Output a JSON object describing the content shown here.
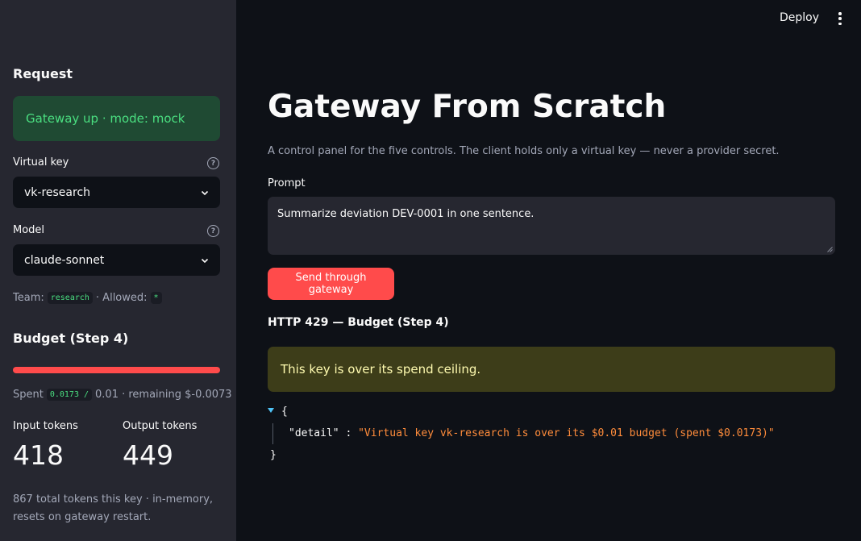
{
  "header": {
    "deploy_label": "Deploy"
  },
  "sidebar": {
    "request_heading": "Request",
    "status_text": "Gateway up · mode: mock",
    "virtual_key": {
      "label": "Virtual key",
      "value": "vk-research"
    },
    "model": {
      "label": "Model",
      "value": "claude-sonnet"
    },
    "team_label": "Team:",
    "team_value": "research",
    "allowed_label": "· Allowed:",
    "allowed_value": "*",
    "budget_heading": "Budget (Step 4)",
    "budget_progress": 1.0,
    "spent_label": "Spent",
    "spent_value": "0.0173 /",
    "spent_rest": "0.01 · remaining $-0.0073",
    "input_tokens": {
      "label": "Input tokens",
      "value": "418"
    },
    "output_tokens": {
      "label": "Output tokens",
      "value": "449"
    },
    "footer_text": "867 total tokens this key · in-memory, resets on gateway restart."
  },
  "main": {
    "title": "Gateway From Scratch",
    "subtitle": "A control panel for the five controls. The client holds only a virtual key — never a provider secret.",
    "prompt_label": "Prompt",
    "prompt_value": "Summarize deviation DEV-0001 in one sentence.",
    "send_label": "Send through gateway",
    "response_heading": "HTTP 429 — Budget (Step 4)",
    "warning_text": "This key is over its spend ceiling.",
    "json": {
      "open": "{",
      "key": "\"detail\"",
      "colon": " : ",
      "value": "\"Virtual key vk-research is over its $0.01 budget (spent $0.0173)\"",
      "close": "}"
    }
  },
  "colors": {
    "accent": "#ff4b4b",
    "success": "#4ade80",
    "warning_bg": "#3d3d19",
    "json_string": "#ff8c3b"
  }
}
